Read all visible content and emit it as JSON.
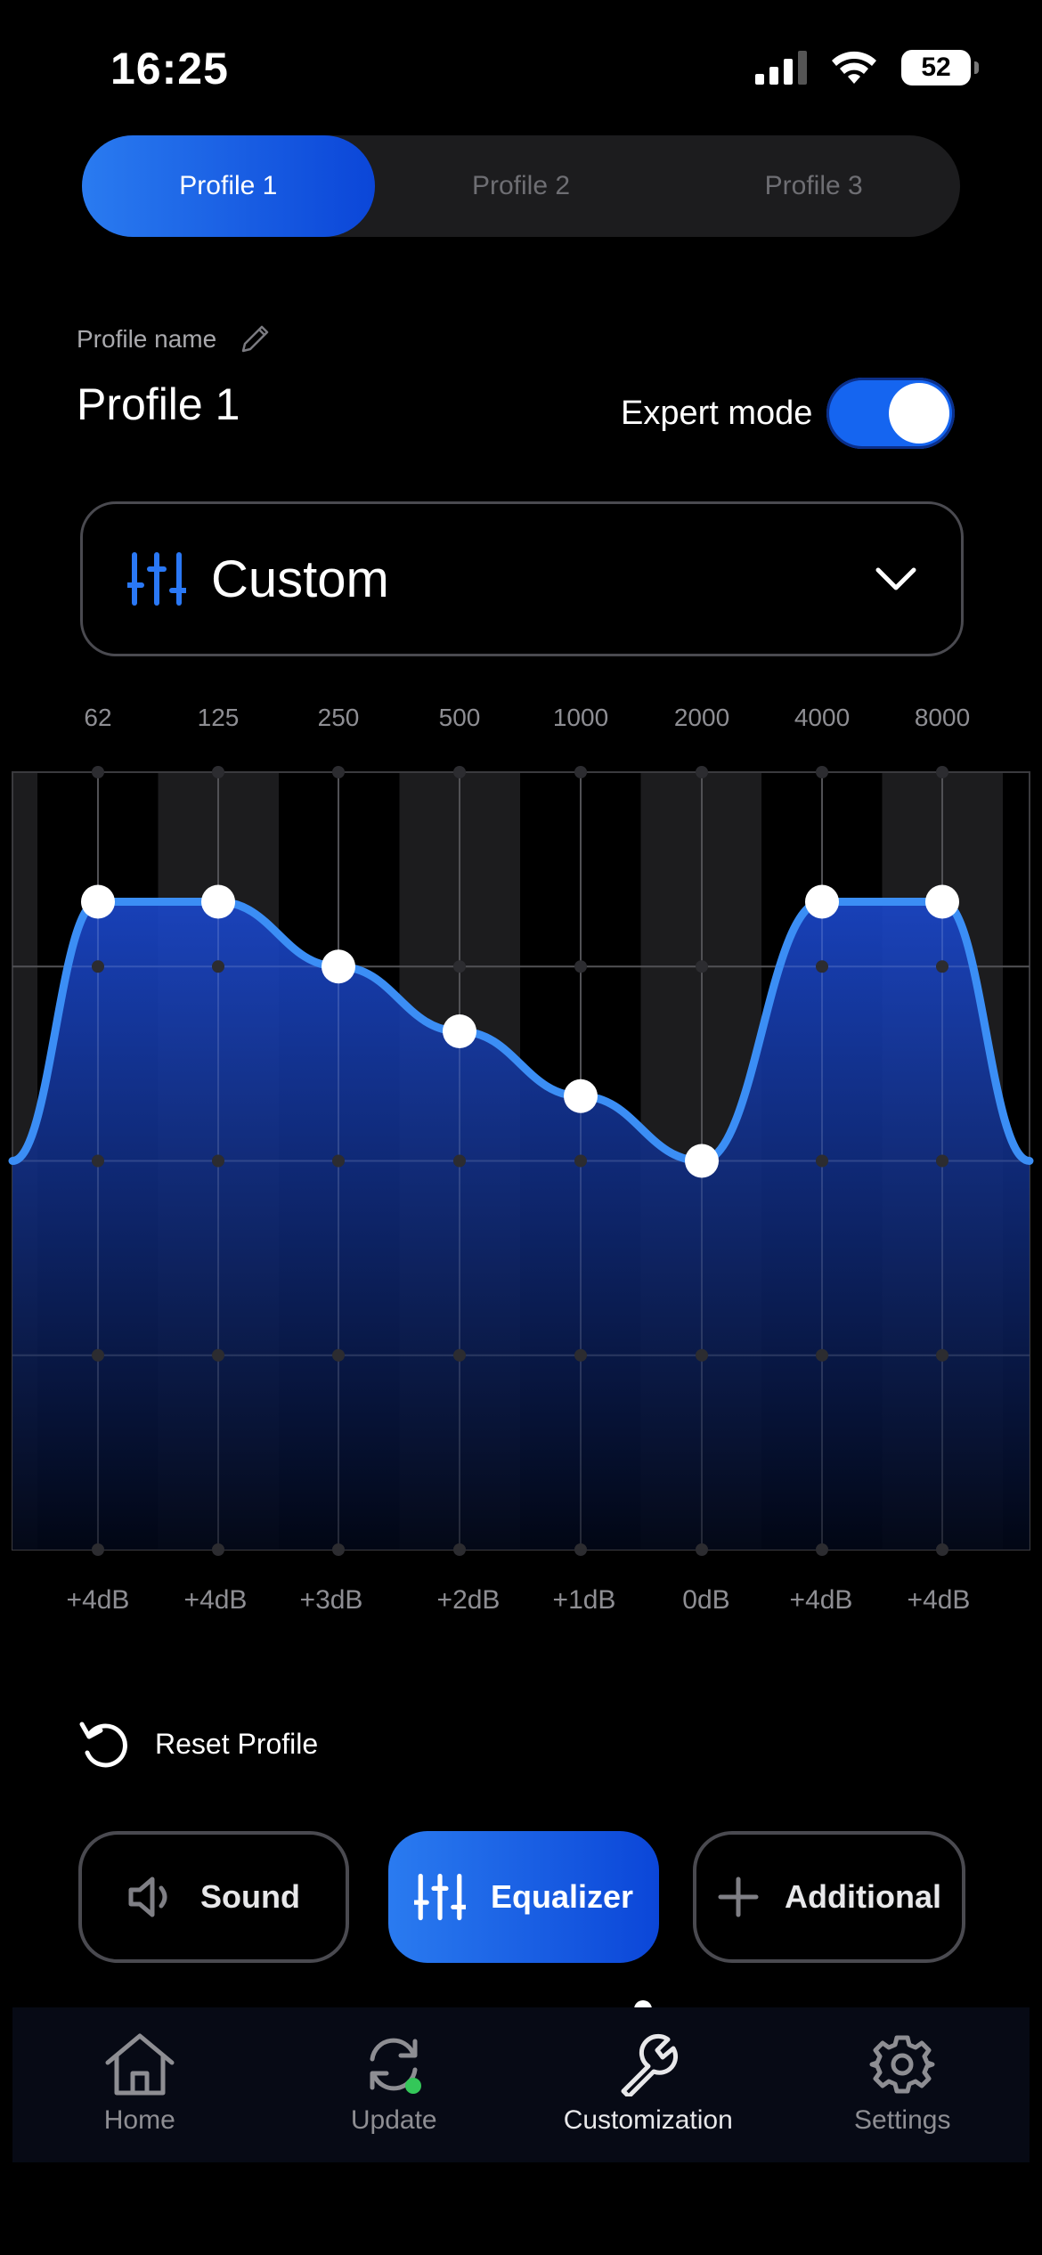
{
  "status_bar": {
    "time": "16:25",
    "battery": "52",
    "icons": [
      "signal-icon",
      "wifi-icon",
      "battery-icon"
    ]
  },
  "profile_tabs": [
    {
      "label": "Profile 1",
      "active": true
    },
    {
      "label": "Profile 2",
      "active": false
    },
    {
      "label": "Profile 3",
      "active": false
    }
  ],
  "profile": {
    "name_label": "Profile name",
    "name": "Profile 1",
    "edit_icon": "pencil-icon"
  },
  "expert_mode": {
    "label": "Expert mode",
    "enabled": true
  },
  "preset": {
    "label": "Custom",
    "icon": "sliders-icon",
    "chevron": "chevron-down-icon"
  },
  "chart_data": {
    "type": "line",
    "x": [
      "62",
      "125",
      "250",
      "500",
      "1000",
      "2000",
      "4000",
      "8000"
    ],
    "values": [
      4,
      4,
      3,
      2,
      1,
      0,
      4,
      4
    ],
    "point_labels": [
      "+4dB",
      "+4dB",
      "+3dB",
      "+2dB",
      "+1dB",
      "0dB",
      "+4dB",
      "+4dB"
    ],
    "ylim": [
      -6,
      6
    ],
    "grid": true,
    "colors": {
      "line": "#3b8ef5",
      "fill_top": "#1a46c8",
      "fill_bottom": "#020716",
      "point": "#ffffff",
      "stripe": "#1c1c1e"
    }
  },
  "reset": {
    "label": "Reset Profile",
    "icon": "reset-icon"
  },
  "segments": [
    {
      "label": "Sound",
      "icon": "speaker-icon",
      "active": false
    },
    {
      "label": "Equalizer",
      "icon": "sliders-icon",
      "active": true
    },
    {
      "label": "Additional",
      "icon": "plus-icon",
      "active": false
    }
  ],
  "bottom_nav": [
    {
      "label": "Home",
      "icon": "home-icon",
      "active": false
    },
    {
      "label": "Update",
      "icon": "refresh-icon",
      "active": false,
      "badge_color": "#34c759"
    },
    {
      "label": "Customization",
      "icon": "wrench-icon",
      "active": true
    },
    {
      "label": "Settings",
      "icon": "gear-icon",
      "active": false
    }
  ],
  "accent": "#1565f0"
}
